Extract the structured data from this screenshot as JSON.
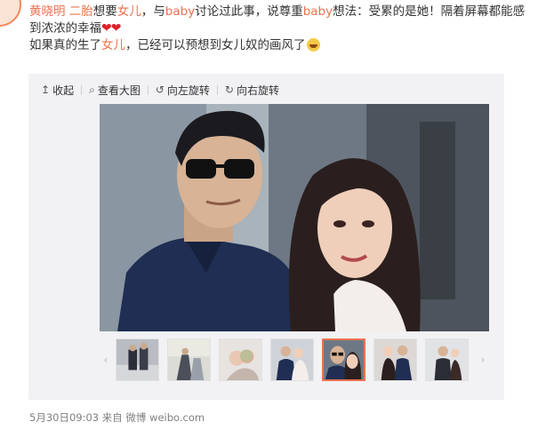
{
  "post": {
    "author": "黄晓明",
    "line1_a": "二胎",
    "line1_b": "想要",
    "line1_c": "女儿",
    "line1_d": "，与",
    "line1_e": "baby",
    "line1_f": "讨论过此事，说尊重",
    "line1_g": "baby",
    "line1_h": "想法：受累的是她！隔着屏幕都能感",
    "line2": "到浓浓的幸福",
    "hearts": "❤❤",
    "line3_a": "如果真的生了",
    "line3_b": "女儿",
    "line3_c": "，已经可以预想到女儿奴的画风了"
  },
  "toolbar": {
    "collapse": {
      "icon": "↥",
      "label": "收起"
    },
    "view_large": {
      "icon": "⌕",
      "label": "查看大图"
    },
    "rotate_left": {
      "icon": "↺",
      "label": "向左旋转"
    },
    "rotate_right": {
      "icon": "↻",
      "label": "向右旋转"
    }
  },
  "gallery": {
    "prev": "‹",
    "next": "›",
    "thumb_count": 7,
    "active_index": 4
  },
  "footer": {
    "time": "5月30日09:03",
    "from": "来自",
    "source": "微博 weibo.com"
  },
  "colors": {
    "accent": "#eb7350",
    "heart": "#e0202c"
  }
}
